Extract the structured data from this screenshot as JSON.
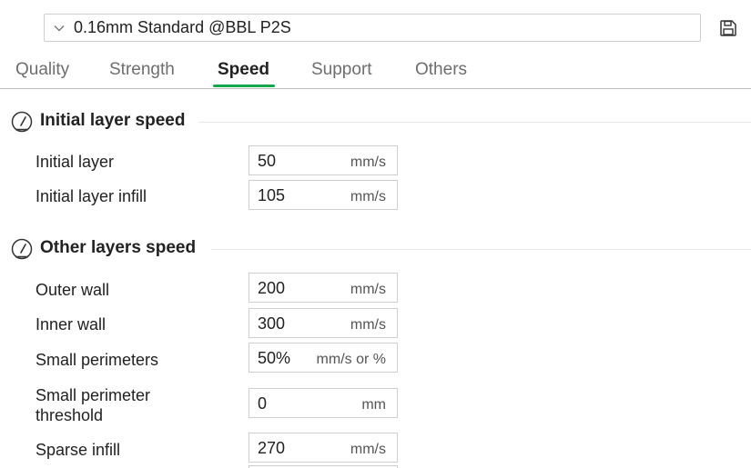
{
  "preset": {
    "name": "0.16mm Standard @BBL P2S",
    "chevron_icon": "chevron-down-icon",
    "save_icon": "save-icon"
  },
  "tabs": [
    {
      "label": "Quality",
      "active": false
    },
    {
      "label": "Strength",
      "active": false
    },
    {
      "label": "Speed",
      "active": true
    },
    {
      "label": "Support",
      "active": false
    },
    {
      "label": "Others",
      "active": false
    }
  ],
  "accent_color": "#12a74a",
  "sections": [
    {
      "title": "Initial layer speed",
      "icon": "speedometer-icon",
      "rows": [
        {
          "label": "Initial layer",
          "value": "50",
          "unit": "mm/s"
        },
        {
          "label": "Initial layer infill",
          "value": "105",
          "unit": "mm/s"
        }
      ]
    },
    {
      "title": "Other layers speed",
      "icon": "speedometer-icon",
      "rows": [
        {
          "label": "Outer wall",
          "value": "200",
          "unit": "mm/s"
        },
        {
          "label": "Inner wall",
          "value": "300",
          "unit": "mm/s"
        },
        {
          "label": "Small perimeters",
          "value": "50%",
          "unit": "mm/s or %"
        },
        {
          "label_line1": "Small perimeter",
          "label_line2": "threshold",
          "value": "0",
          "unit": "mm"
        },
        {
          "label": "Sparse infill",
          "value": "270",
          "unit": "mm/s"
        }
      ]
    }
  ]
}
